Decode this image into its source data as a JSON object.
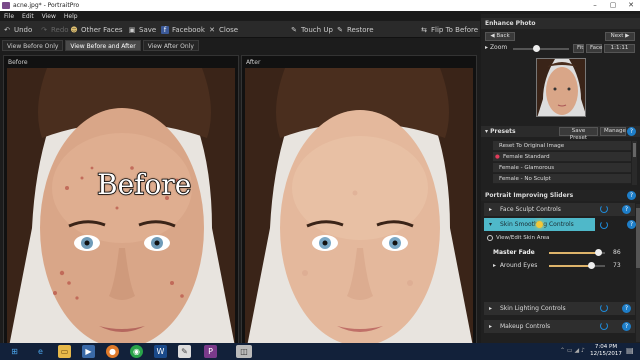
{
  "titlebar": {
    "title": "acne.jpg* - PortraitPro"
  },
  "menu": [
    "File",
    "Edit",
    "View",
    "Help"
  ],
  "toolbar": {
    "undo": "Undo",
    "redo": "Redo",
    "other_faces": "Other Faces",
    "save": "Save",
    "facebook": "Facebook",
    "close": "Close",
    "touch_up": "Touch Up",
    "restore": "Restore",
    "flip_to_before": "Flip To Before"
  },
  "view_tabs": [
    "View Before Only",
    "View Before and After",
    "View After Only"
  ],
  "panels": {
    "before_label": "Before",
    "after_label": "After",
    "before_caption": "Before"
  },
  "enhance": {
    "title": "Enhance Photo",
    "back": "Back",
    "next": "Next",
    "zoom": "Zoom",
    "fit": "Fit",
    "face": "Face",
    "ratio": "1:1:11"
  },
  "presets": {
    "title": "Presets",
    "save_preset": "Save Preset",
    "manage": "Manage",
    "items": [
      "Reset To Original Image",
      "Female Standard",
      "Female - Glamorous",
      "Female - No Sculpt"
    ]
  },
  "sliders": {
    "title": "Portrait Improving Sliders",
    "face_sculpt": "Face Sculpt Controls",
    "skin_smoothing": "Skin Smoothing Controls",
    "view_edit_skin": "View/Edit Skin Area",
    "master_fade": "Master Fade",
    "master_fade_value": "86",
    "around_eyes": "Around Eyes",
    "around_eyes_value": "73",
    "skin_lighting": "Skin Lighting Controls",
    "makeup": "Makeup Controls"
  },
  "taskbar": {
    "time": "7:04 PM",
    "date": "12/15/2017"
  },
  "colors": {
    "accent": "#1e7ec8",
    "selected_control": "#4fb8c9",
    "slider_fill": "#ddb36a"
  }
}
